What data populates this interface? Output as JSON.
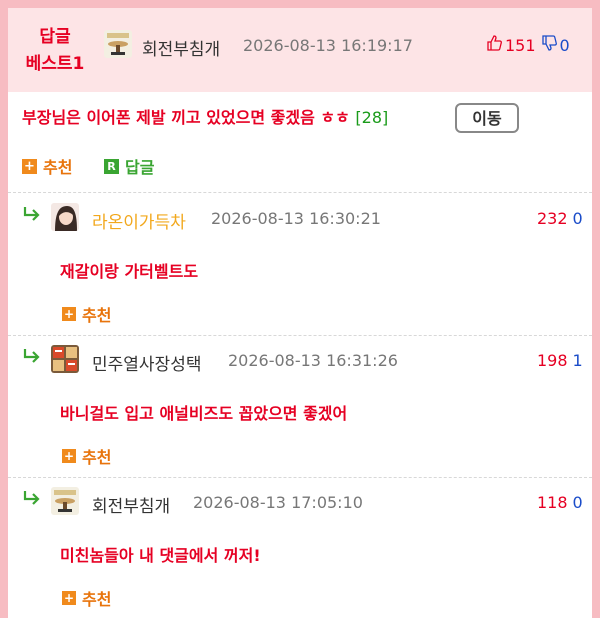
{
  "post": {
    "badge_line1": "답글",
    "badge_line2": "베스트1",
    "author": "회전부침개",
    "date": "2026-08-13 16:19:17",
    "up_votes": "151",
    "down_votes": "0",
    "title": "부장님은 이어폰 제발 끼고 있었으면 좋겠음 ㅎㅎ",
    "comment_count": "[28]",
    "move_label": "이동",
    "recommend_label": "추천",
    "reply_label": "답글",
    "reply_box_letter": "R"
  },
  "comments": [
    {
      "author": "라온이가득차",
      "author_color": "#f2a81d",
      "date": "2026-08-13 16:30:21",
      "up_votes": "232",
      "down_votes": "0",
      "text": "재갈이랑 가터벨트도",
      "recommend_label": "추천"
    },
    {
      "author": "민주열사장성택",
      "author_color": "#333333",
      "date": "2026-08-13 16:31:26",
      "up_votes": "198",
      "down_votes": "1",
      "text": "바니걸도 입고 애널비즈도 꼽았으면 좋겠어",
      "recommend_label": "추천"
    },
    {
      "author": "회전부침개",
      "author_color": "#333333",
      "date": "2026-08-13 17:05:10",
      "up_votes": "118",
      "down_votes": "0",
      "text": "미친놈들아 내 댓글에서 꺼저!",
      "recommend_label": "추천"
    }
  ],
  "colors": {
    "accent_red": "#e60023",
    "down_blue": "#1a4cc9",
    "reply_green": "#3aa532",
    "recommend_orange": "#e8740c",
    "header_bg": "#fde4e6",
    "frame_pink": "#f7bcc2"
  },
  "icons": {
    "thumbs_up": "thumbs-up-icon",
    "thumbs_down": "thumbs-down-icon",
    "reply_arrow": "reply-arrow-icon",
    "plus": "plus-icon"
  }
}
